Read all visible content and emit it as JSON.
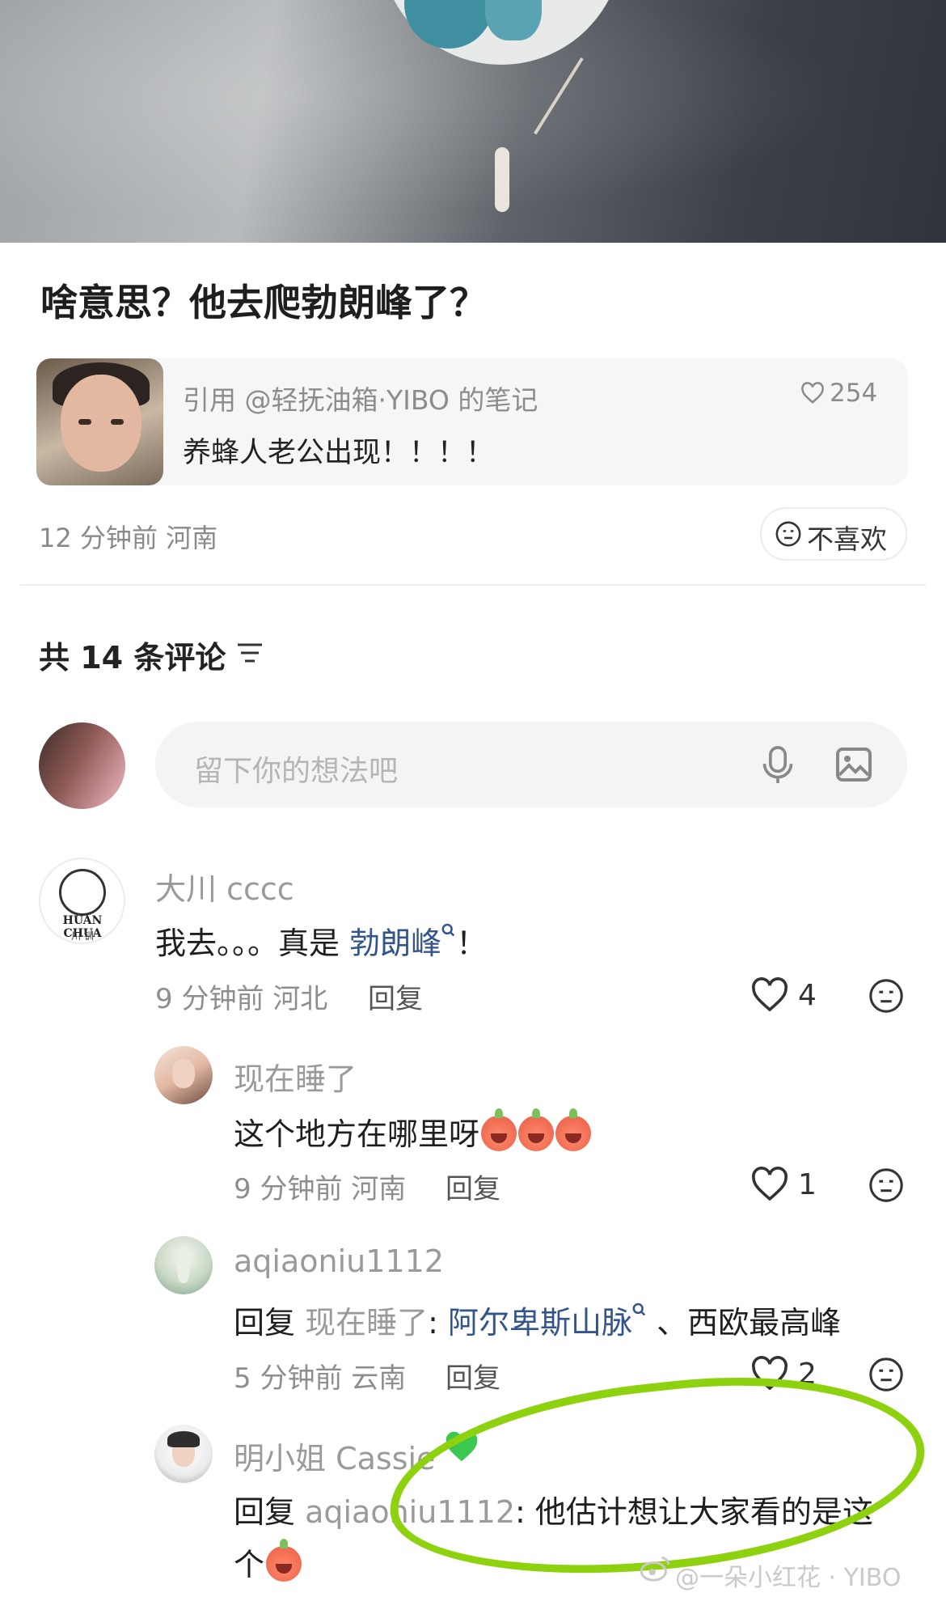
{
  "post": {
    "title": "啥意思？他去爬勃朗峰了？",
    "quote": {
      "source": "引用 @轻抚油箱·YIBO 的笔记",
      "likes": "254",
      "text": "养蜂人老公出现！！！！"
    },
    "meta": "12 分钟前 河南",
    "dislike_label": "不喜欢"
  },
  "comments_section": {
    "count_label": "共 14 条评论",
    "input_placeholder": "留下你的想法吧"
  },
  "comments": [
    {
      "username": "大川 cccc",
      "avatar_text": "HUAN CHUA",
      "avatar_subtext": "川·钏",
      "text_prefix": "我去。。。真是 ",
      "text_link": "勃朗峰",
      "text_suffix": "！",
      "meta": "9 分钟前 河北",
      "reply_label": "回复",
      "likes": "4"
    },
    {
      "username": "现在睡了",
      "text": "这个地方在哪里呀",
      "meta": "9 分钟前 河南",
      "reply_label": "回复",
      "likes": "1"
    },
    {
      "username": "aqiaoniu1112",
      "reply_prefix": "回复 ",
      "reply_to": "现在睡了",
      "colon": ": ",
      "text_link": "阿尔卑斯山脉",
      "text_suffix": " 、西欧最高峰",
      "meta": "5 分钟前 云南",
      "reply_label": "回复",
      "likes": "2"
    },
    {
      "username": "明小姐 Cassie",
      "reply_prefix": "回复 ",
      "reply_to": "aqiaoniu1112",
      "colon": ": ",
      "text": "他估计想让大家看的是这",
      "text_line2": "个"
    }
  ],
  "watermark": "@一朵小红花 · YIBO",
  "colors": {
    "link": "#34558b",
    "highlight": "#8ed20f",
    "meta_grey": "#8e8e8e"
  },
  "icons": [
    "sort-icon",
    "mic-icon",
    "image-icon",
    "heart-icon",
    "dislike-face-icon",
    "search-mini-icon",
    "green-heart-icon"
  ]
}
